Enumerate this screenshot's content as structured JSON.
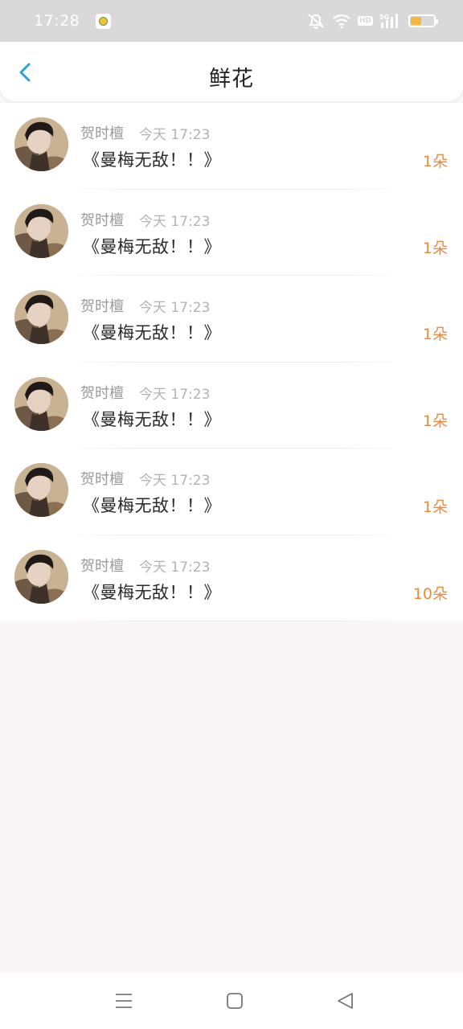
{
  "status_bar": {
    "time": "17:28",
    "notification_icon": "app-notification-icon",
    "icons": [
      "mute-icon",
      "wifi-icon",
      "hd-icon",
      "5g-signal-icon",
      "battery-icon"
    ],
    "hd_label": "HD",
    "battery_level": 0.45
  },
  "header": {
    "back_icon": "chevron-left-icon",
    "title": "鲜花"
  },
  "list": [
    {
      "name": "贺时檀",
      "time": "今天 17:23",
      "message": "《曼梅无敌！！》",
      "count": "1朵"
    },
    {
      "name": "贺时檀",
      "time": "今天 17:23",
      "message": "《曼梅无敌！！》",
      "count": "1朵"
    },
    {
      "name": "贺时檀",
      "time": "今天 17:23",
      "message": "《曼梅无敌！！》",
      "count": "1朵"
    },
    {
      "name": "贺时檀",
      "time": "今天 17:23",
      "message": "《曼梅无敌！！》",
      "count": "1朵"
    },
    {
      "name": "贺时檀",
      "time": "今天 17:23",
      "message": "《曼梅无敌！！》",
      "count": "1朵"
    },
    {
      "name": "贺时檀",
      "time": "今天 17:23",
      "message": "《曼梅无敌！！》",
      "count": "10朵"
    }
  ],
  "nav_bar": {
    "icons": [
      "menu-icon",
      "home-square-icon",
      "back-triangle-icon"
    ]
  },
  "colors": {
    "accent_blue": "#2a9fe3",
    "count_orange": "#ee8a3e",
    "battery_yellow": "#f4b73a"
  }
}
